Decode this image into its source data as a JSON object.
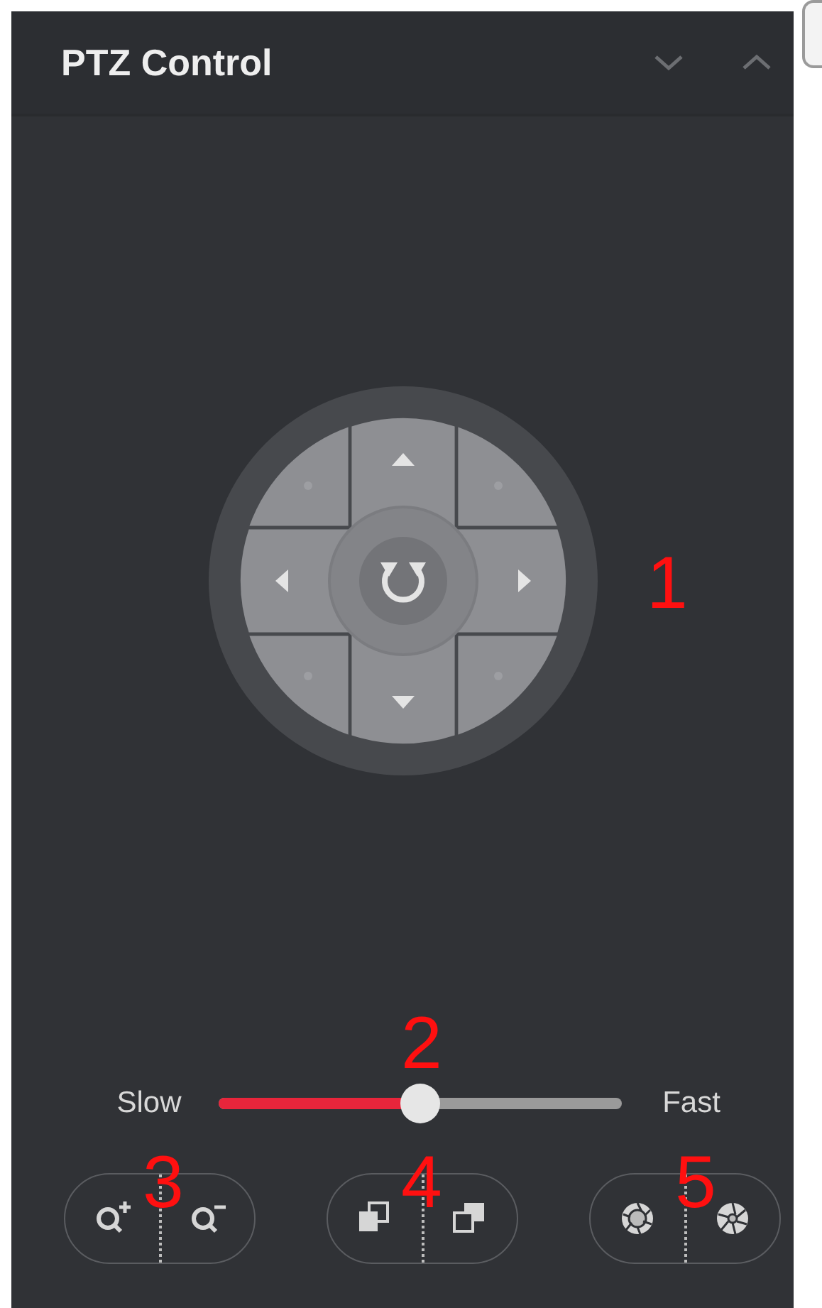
{
  "panel": {
    "title": "PTZ Control"
  },
  "speed": {
    "min_label": "Slow",
    "max_label": "Fast",
    "level": 0.5
  },
  "button_groups": [
    {
      "kind": "zoom"
    },
    {
      "kind": "focus"
    },
    {
      "kind": "iris"
    }
  ],
  "callouts": [
    {
      "text": "1",
      "kind": "joystick"
    },
    {
      "text": "2",
      "kind": "slider"
    },
    {
      "text": "3",
      "kind": "group"
    },
    {
      "text": "4",
      "kind": "group"
    },
    {
      "text": "5",
      "kind": "group"
    }
  ]
}
